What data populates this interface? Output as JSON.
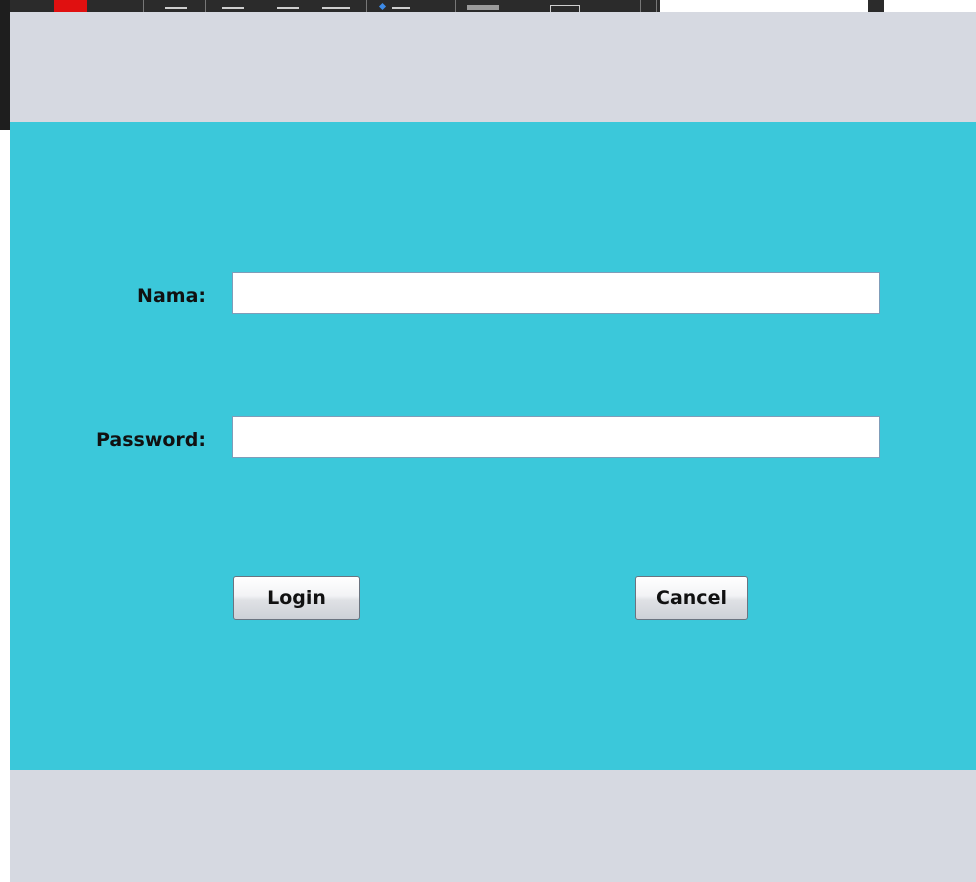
{
  "login_form": {
    "nama_label": "Nama:",
    "nama_value": "",
    "password_label": "Password:",
    "password_value": "",
    "login_button": "Login",
    "cancel_button": "Cancel"
  },
  "colors": {
    "panel_background": "#3bc8da",
    "window_background": "#d6d9e1",
    "field_background": "#ffffff"
  }
}
